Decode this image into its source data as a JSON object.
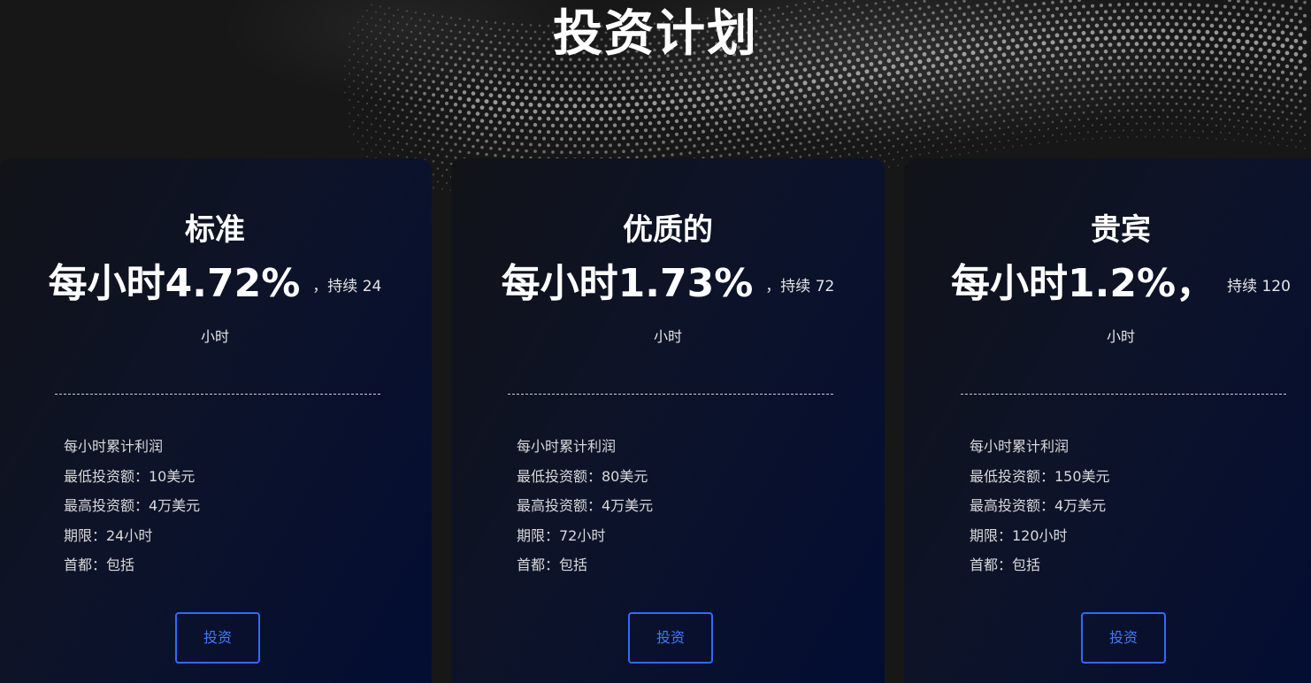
{
  "page": {
    "title": "投资计划"
  },
  "plans": [
    {
      "name": "标准",
      "rate": "每小时4.72%",
      "duration_prefix": "，持续 24",
      "duration_unit": "小时",
      "details": [
        "每小时累计利润",
        "最低投资额：10美元",
        "最高投资额：4万美元",
        "期限：24小时",
        "首都：包括"
      ],
      "button_label": "投资"
    },
    {
      "name": "优质的",
      "rate": "每小时1.73%",
      "duration_prefix": "，持续 72",
      "duration_unit": "小时",
      "details": [
        "每小时累计利润",
        "最低投资额：80美元",
        "最高投资额：4万美元",
        "期限：72小时",
        "首都：包括"
      ],
      "button_label": "投资"
    },
    {
      "name": "贵宾",
      "rate": "每小时1.2%，",
      "duration_prefix": "持续 120",
      "duration_unit": "小时",
      "details": [
        "每小时累计利润",
        "最低投资额：150美元",
        "最高投资额：4万美元",
        "期限：120小时",
        "首都：包括"
      ],
      "button_label": "投资"
    }
  ],
  "colors": {
    "background": "#171717",
    "card_gradient_end": "#020d33",
    "accent_button": "#2f6bff"
  }
}
